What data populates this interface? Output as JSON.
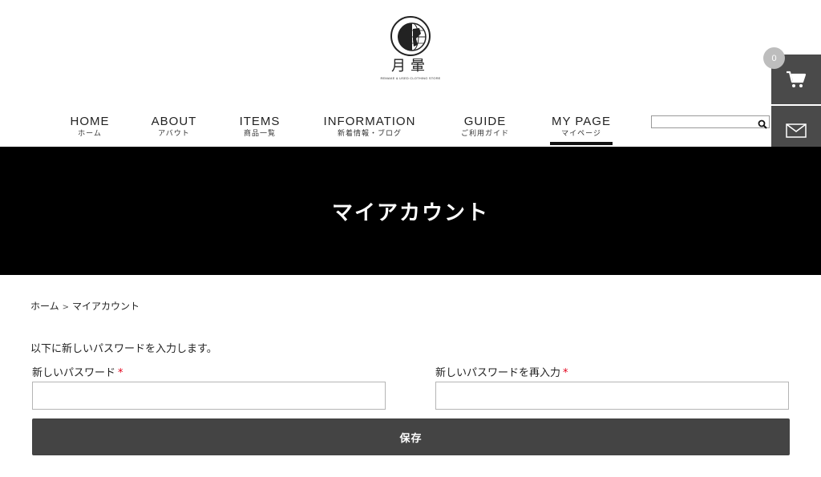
{
  "header": {
    "brand_name": "月暈",
    "brand_tagline": "REMAKE & USED CLOTHING STORE",
    "logo_icon": "moon-globe-logo"
  },
  "nav": {
    "items": [
      {
        "en": "HOME",
        "ja": "ホーム"
      },
      {
        "en": "ABOUT",
        "ja": "アバウト"
      },
      {
        "en": "ITEMS",
        "ja": "商品一覧"
      },
      {
        "en": "INFORMATION",
        "ja": "新着情報・ブログ"
      },
      {
        "en": "GUIDE",
        "ja": "ご利用ガイド"
      },
      {
        "en": "MY PAGE",
        "ja": "マイページ"
      }
    ],
    "active": "MY PAGE"
  },
  "search": {
    "placeholder": "",
    "icon": "search-icon"
  },
  "side_widgets": {
    "cart_count": "0",
    "cart_icon": "cart-icon",
    "mail_icon": "mail-icon",
    "favorite_icon": "heart-icon"
  },
  "hero": {
    "title": "マイアカウント"
  },
  "breadcrumb": {
    "home": "ホーム",
    "separator": ">",
    "current": "マイアカウント"
  },
  "form": {
    "intro": "以下に新しいパスワードを入力します。",
    "new_password_label": "新しいパスワード",
    "confirm_password_label": "新しいパスワードを再入力",
    "required_mark": "*",
    "new_password_value": "",
    "confirm_password_value": "",
    "save_label": "保存"
  },
  "colors": {
    "hero_bg": "#000000",
    "button_bg": "#444444",
    "side_bg": "#4a4a4a",
    "required": "#e2001a",
    "badge_bg": "#bdbdbd"
  }
}
